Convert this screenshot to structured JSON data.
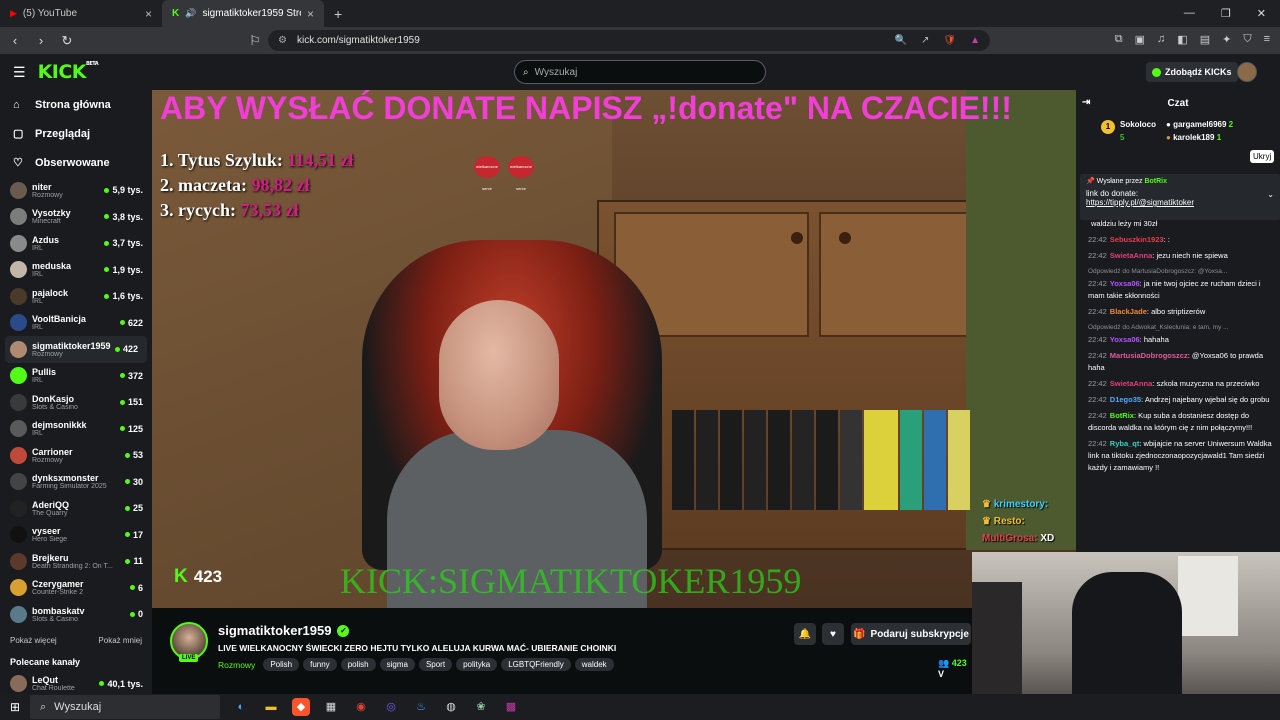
{
  "browser": {
    "tabs": [
      {
        "label": "(5) YouTube",
        "active": false
      },
      {
        "label": "sigmatiktoker1959 Stream - ·",
        "active": true
      }
    ],
    "url": "kick.com/sigmatiktoker1959"
  },
  "header": {
    "logo": "KICK",
    "logo_sup": "BETA",
    "search_placeholder": "Wyszukaj",
    "kicks_button": "Zdobądź KICKs"
  },
  "sidebar": {
    "nav": [
      {
        "label": "Strona główna",
        "icon": "home-icon"
      },
      {
        "label": "Przeglądaj",
        "icon": "browse-icon"
      },
      {
        "label": "Obserwowane",
        "icon": "heart-icon"
      }
    ],
    "channels": [
      {
        "name": "niter",
        "category": "Rozmowy",
        "viewers": "5,9 tys.",
        "color": "#6a5a50"
      },
      {
        "name": "Vysotzky",
        "category": "Minecraft",
        "viewers": "3,8 tys.",
        "color": "#7c7c7c"
      },
      {
        "name": "Azdus",
        "category": "IRL",
        "viewers": "3,7 tys.",
        "color": "#8a8a8a"
      },
      {
        "name": "meduska",
        "category": "IRL",
        "viewers": "1,9 tys.",
        "color": "#c3b6a8"
      },
      {
        "name": "pajalock",
        "category": "IRL",
        "viewers": "1,6 tys.",
        "color": "#4a3a2a"
      },
      {
        "name": "VooltBanicja",
        "category": "IRL",
        "viewers": "622",
        "color": "#2a4a8a"
      },
      {
        "name": "sigmatiktoker1959",
        "category": "Rozmowy",
        "viewers": "422",
        "color": "#b08a70"
      },
      {
        "name": "Pullis",
        "category": "IRL",
        "viewers": "372",
        "color": "#53fc18"
      },
      {
        "name": "DonKasjo",
        "category": "Slots & Casino",
        "viewers": "151",
        "color": "#3a3a3a"
      },
      {
        "name": "dejmsonikkk",
        "category": "IRL",
        "viewers": "125",
        "color": "#5a5a5a"
      },
      {
        "name": "Carrioner",
        "category": "Rozmowy",
        "viewers": "53",
        "color": "#c04a3a"
      },
      {
        "name": "dynksxmonster",
        "category": "Farming Simulator 2025",
        "viewers": "30",
        "color": "#444"
      },
      {
        "name": "AderiQQ",
        "category": "The Quarry",
        "viewers": "25",
        "color": "#222"
      },
      {
        "name": "vyseer",
        "category": "Hero Siege",
        "viewers": "17",
        "color": "#111"
      },
      {
        "name": "Brejkeru",
        "category": "Death Stranding 2: On T...",
        "viewers": "11",
        "color": "#5a3a2a"
      },
      {
        "name": "Czerygamer",
        "category": "Counter-Strike 2",
        "viewers": "6",
        "color": "#d8a030"
      },
      {
        "name": "bombaskatv",
        "category": "Slots & Casino",
        "viewers": "0",
        "color": "#5a7a8a"
      }
    ],
    "show_more": "Pokaż więcej",
    "show_less": "Pokaż mniej",
    "recommended_title": "Polecane kanały",
    "recommended": [
      {
        "name": "LeQut",
        "category": "Chat Roulette",
        "viewers": "40,1 tys.",
        "color": "#8a6a5a"
      }
    ]
  },
  "video": {
    "banner": "ABY WYSŁAĆ DONATE NAPISZ „!donate\" NA CZACIE!!!",
    "donors": [
      {
        "rank": "1.",
        "name": "Tytus Szyluk:",
        "amount": "114,51 zł"
      },
      {
        "rank": "2.",
        "name": "maczeta:",
        "amount": "98,82 zł"
      },
      {
        "rank": "3.",
        "name": "rycych:",
        "amount": "73,53 zł"
      }
    ],
    "heart_text": "wielkanocne serce",
    "viewer_count": "423",
    "watermark": "KICK:SIGMATIKTOKER1959",
    "overlay_chat": [
      {
        "name": "krimestory:",
        "text": ""
      },
      {
        "name": "Resto:",
        "text": ""
      },
      {
        "name": "MultiGrosa:",
        "text": "XD"
      }
    ]
  },
  "stream": {
    "name": "sigmatiktoker1959",
    "live": "LIVE",
    "title": "LIVE WIELKANOCNY ŚWIECKI ZERO HEJTU TYLKO ALELUJA KURWA MAĆ- UBIERANIE CHOINKI",
    "category": "Rozmowy",
    "tags": [
      "Polish",
      "funny",
      "polish",
      "sigma",
      "Sport",
      "polityka",
      "LGBTQFriendly",
      "waldek"
    ],
    "subscribe_label": "Podaruj subskrypcje",
    "viewers": "423",
    "viewers_suffix": "V"
  },
  "chat": {
    "title": "Czat",
    "leaderboard": {
      "rank1": "1",
      "rank1_name": "Sokoloco",
      "rank1_count": "5",
      "second": "gargamel6969",
      "second_count": "2",
      "third": "karolek189",
      "third_count": "1"
    },
    "tooltip": "Ukryj",
    "pinned": {
      "by_label": "Wysłane przez",
      "by_name": "BotRix",
      "line1": "link do donate:",
      "link": "https://tipply.pl/@sigmatiktoker"
    },
    "messages": [
      {
        "time": "",
        "name": "",
        "color": "#fff",
        "text": "waldziu leży mi 30zł",
        "reply": ""
      },
      {
        "time": "22:42",
        "name": "Sebuszkin1923",
        "color": "#e3404d",
        "text": ":",
        "reply": ""
      },
      {
        "time": "22:42",
        "name": "SwietaAnna",
        "color": "#e0407a",
        "text": "jezu niech nie spiewa",
        "reply": ""
      },
      {
        "time": "22:42",
        "name": "Yoxsa06",
        "color": "#b455ff",
        "text": "ja nie twoj ojciec ze rucham dzieci i mam takie skłonności",
        "reply": "Odpowiedź do MartusiaDobrogoszcz: @Yoxsa..."
      },
      {
        "time": "22:42",
        "name": "BlackJade",
        "color": "#f08a30",
        "text": "albo striptizerów",
        "reply": ""
      },
      {
        "time": "22:42",
        "name": "Yoxsa06",
        "color": "#b455ff",
        "text": "hahaha",
        "reply": "Odpowiedź do Adwokat_Kslecłunia: e tam, my ..."
      },
      {
        "time": "22:42",
        "name": "MartusiaDobrogoszcz",
        "color": "#e05aa0",
        "text": "@Yoxsa06 to prawda haha",
        "reply": ""
      },
      {
        "time": "22:42",
        "name": "SwietaAnna",
        "color": "#e0407a",
        "text": "szkola muzyczna na przeciwko",
        "reply": ""
      },
      {
        "time": "22:42",
        "name": "D1ego35",
        "color": "#53a8ff",
        "text": "Andrzej najebany wjebał się do grobu",
        "reply": ""
      },
      {
        "time": "22:42",
        "name": "BotRix",
        "color": "#53fc18",
        "text": "Kup suba a dostaniesz dostęp do discorda waldka na którym cię z nim połączymy!!!",
        "reply": ""
      },
      {
        "time": "22:42",
        "name": "Ryba_qt",
        "color": "#3ad1c0",
        "text": "wbijajcie na server Uniwersum Waldka link na tiktoku zjednoczonaopozycjawald1 Tam siedzi każdy i zamawiamy !!",
        "reply": ""
      }
    ]
  },
  "taskbar": {
    "search": "Wyszukaj"
  }
}
